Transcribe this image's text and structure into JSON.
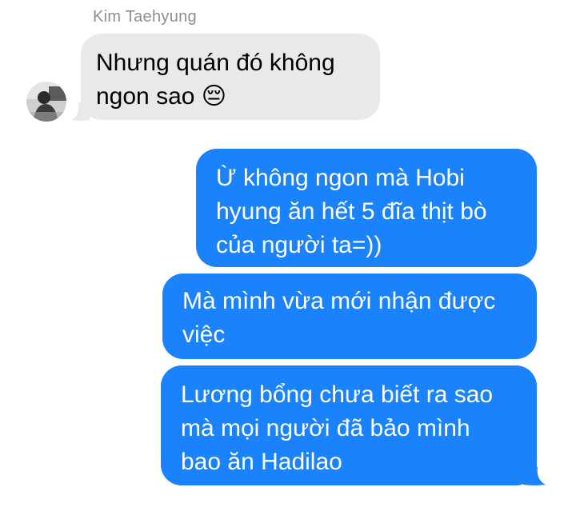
{
  "conversation": {
    "contact_name": "Kim Taehyung",
    "colors": {
      "incoming_bubble": "#e9e9eb",
      "outgoing_bubble": "#1a82fb",
      "incoming_text": "#000000",
      "outgoing_text": "#ffffff",
      "name_text": "#8e8e93"
    },
    "messages": [
      {
        "direction": "incoming",
        "text": "Nhưng quán đó không\nngon sao 😔"
      },
      {
        "direction": "outgoing",
        "text": "Ừ không ngon mà Hobi\nhyung ăn hết 5 đĩa thịt bò\ncủa người ta=))"
      },
      {
        "direction": "outgoing",
        "text": "Mà mình vừa mới nhận được\nviệc"
      },
      {
        "direction": "outgoing",
        "text": "Lương bổng chưa biết ra sao\nmà mọi người đã bảo mình\nbao ăn Hadilao"
      }
    ]
  }
}
